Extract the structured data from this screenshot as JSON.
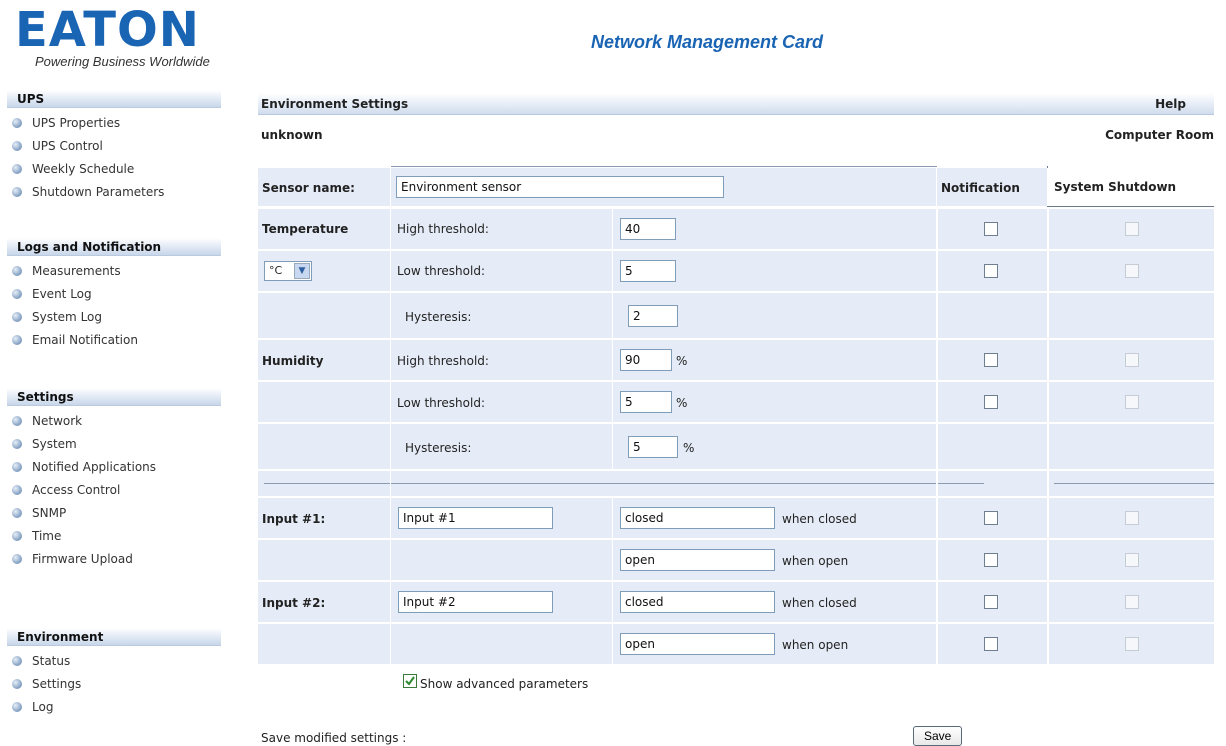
{
  "brand": {
    "logo_text": "EATON",
    "tagline": "Powering Business Worldwide"
  },
  "app": {
    "title": "Network Management Card"
  },
  "sidebar": {
    "sections": [
      {
        "heading": "UPS",
        "items": [
          "UPS Properties",
          "UPS Control",
          "Weekly Schedule",
          "Shutdown Parameters"
        ]
      },
      {
        "heading": "Logs and Notification",
        "items": [
          "Measurements",
          "Event Log",
          "System Log",
          "Email Notification"
        ]
      },
      {
        "heading": "Settings",
        "items": [
          "Network",
          "System",
          "Notified Applications",
          "Access Control",
          "SNMP",
          "Time",
          "Firmware Upload"
        ]
      },
      {
        "heading": "Environment",
        "items": [
          "Status",
          "Settings",
          "Log"
        ]
      }
    ]
  },
  "page": {
    "title": "Environment Settings",
    "help": "Help",
    "location_left": "unknown",
    "location_right": "Computer Room"
  },
  "table": {
    "sensor_label": "Sensor name:",
    "sensor_value": "Environment sensor",
    "col_notification": "Notification",
    "col_shutdown": "System Shutdown",
    "temperature": {
      "label": "Temperature",
      "unit_selected": "°C",
      "high_label": "High threshold:",
      "high_value": "40",
      "low_label": "Low threshold:",
      "low_value": "5",
      "hyst_label": "Hysteresis:",
      "hyst_value": "2"
    },
    "humidity": {
      "label": "Humidity",
      "high_label": "High threshold:",
      "high_value": "90",
      "low_label": "Low threshold:",
      "low_value": "5",
      "hyst_label": "Hysteresis:",
      "hyst_value": "5",
      "unit": "%"
    },
    "inputs": [
      {
        "label": "Input #1:",
        "name": "Input #1",
        "closed_value": "closed",
        "closed_text": "when closed",
        "open_value": "open",
        "open_text": "when open"
      },
      {
        "label": "Input #2:",
        "name": "Input #2",
        "closed_value": "closed",
        "closed_text": "when closed",
        "open_value": "open",
        "open_text": "when open"
      }
    ]
  },
  "footer": {
    "advanced_label": "Show advanced parameters",
    "advanced_checked": true,
    "save_prompt": "Save modified settings :",
    "save_button": "Save"
  }
}
